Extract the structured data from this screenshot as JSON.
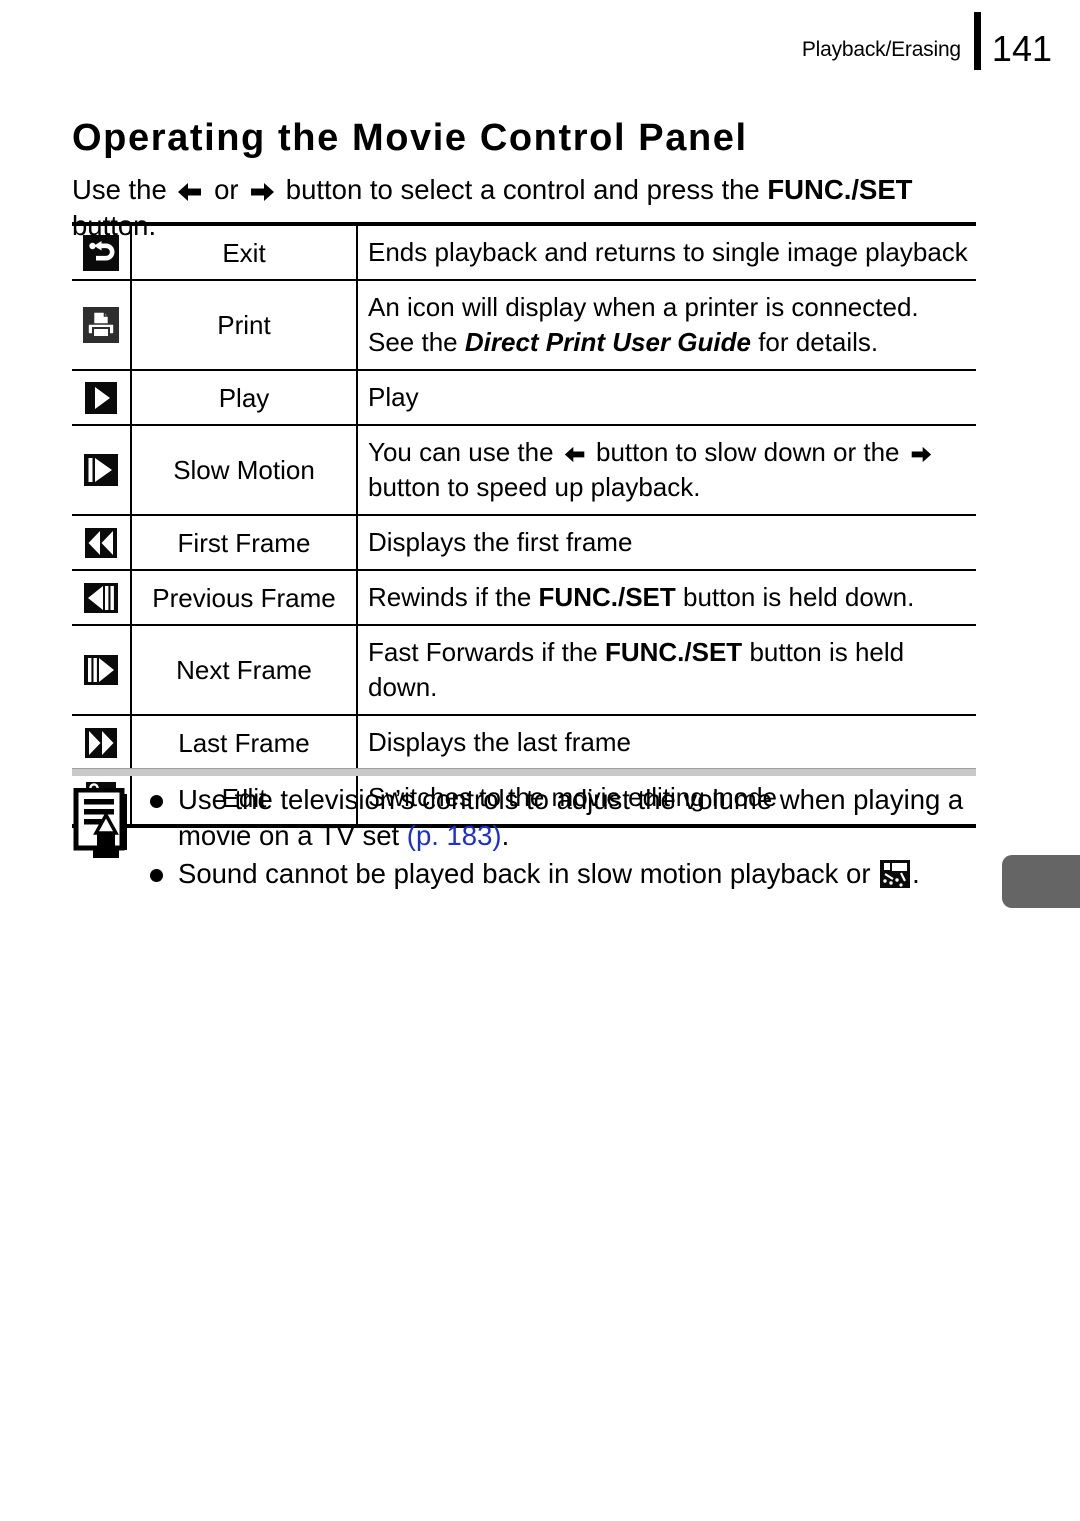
{
  "header": {
    "chapter": "Playback/Erasing",
    "page_number": "141"
  },
  "title": "Operating the Movie Control Panel",
  "intro": {
    "text_before": "Use the",
    "text_middle": "or",
    "text_after": "button to select a control and press the",
    "bold_term": "FUNC./SET",
    "text_end": "button."
  },
  "table": {
    "rows": [
      {
        "icon": "exit-return-icon",
        "name": "Exit",
        "desc": "Ends playback and returns to single image playback"
      },
      {
        "icon": "printer-icon",
        "name": "Print",
        "desc_line1": "An icon will display when a printer is connected.",
        "desc_line2_before": "See the",
        "desc_line2_italic": "Direct Print User Guide",
        "desc_line2_after": "for details."
      },
      {
        "icon": "play-icon",
        "name": "Play",
        "desc": "Play"
      },
      {
        "icon": "slow-motion-icon",
        "name": "Slow Motion",
        "desc_before": "You can use the",
        "desc_middle": "button to slow down or the",
        "desc_after": "button to speed up playback."
      },
      {
        "icon": "first-frame-icon",
        "name": "First Frame",
        "desc": "Displays the first frame"
      },
      {
        "icon": "previous-frame-icon",
        "name": "Previous Frame",
        "desc_before": "Rewinds if the",
        "desc_bold": "FUNC./SET",
        "desc_after": "button is held down."
      },
      {
        "icon": "next-frame-icon",
        "name": "Next Frame",
        "desc_before": "Fast Forwards if the",
        "desc_bold": "FUNC./SET",
        "desc_after": "button is held down."
      },
      {
        "icon": "last-frame-icon",
        "name": "Last Frame",
        "desc": "Displays the last frame"
      },
      {
        "icon": "scissors-edit-icon",
        "name": "Edit",
        "desc": "Switches to the movie editing mode"
      }
    ]
  },
  "note": {
    "icon": "note-pencil-icon",
    "bullet1_before": "Use the television’s controls to adjust the volume when playing a movie on a TV set",
    "bullet1_pageref": "(p. 183)",
    "bullet1_after": ".",
    "bullet2_before": "Sound cannot be played back in slow motion playback or",
    "bullet2_after": "."
  },
  "colors": {
    "page_ref_link": "#1b2fd2",
    "edge_tab": "#656565",
    "separator": "#c9c9c9"
  }
}
